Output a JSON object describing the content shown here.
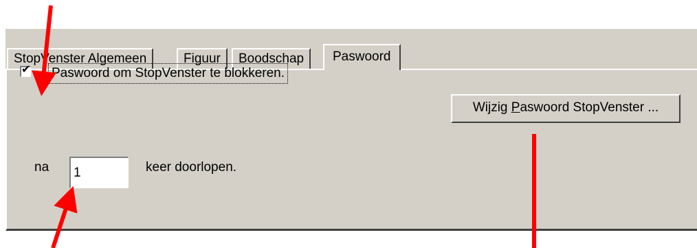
{
  "dialog": {
    "tabs": [
      {
        "label": "StopVenster Algemeen"
      },
      {
        "label": "Figuur"
      },
      {
        "label": "Boodschap"
      },
      {
        "label": "Paswoord"
      }
    ],
    "active_tab": "Paswoord",
    "checkbox": {
      "label": "Paswoord om StopVenster te blokkeren.",
      "checked": true
    },
    "change_button": {
      "prefix": "Wijzig ",
      "accel": "P",
      "suffix": "aswoord StopVenster ..."
    },
    "repeat": {
      "prefix_label": "na",
      "value": "1",
      "suffix_label": "keer doorlopen."
    }
  },
  "colors": {
    "dialog_bg": "#d4d0c8",
    "arrow": "#ff0000"
  }
}
